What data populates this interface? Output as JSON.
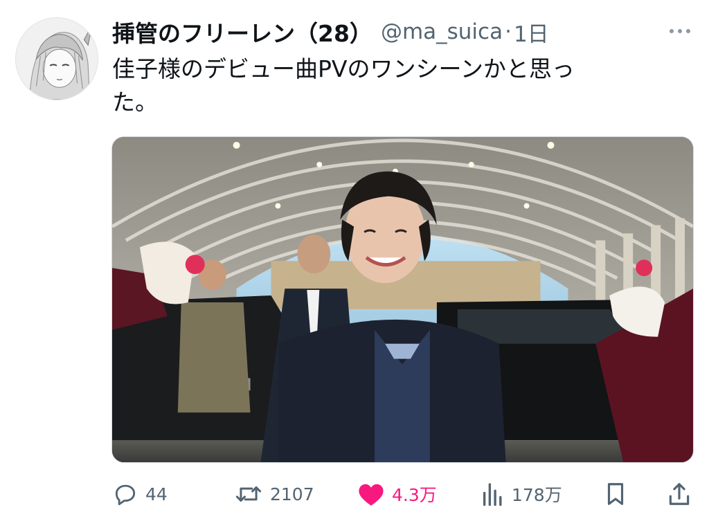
{
  "user": {
    "display_name": "挿管のフリーレン（28）",
    "handle": "@ma_suica",
    "separator": "·",
    "time": "1日",
    "avatar": "anime-girl-sketch-avatar"
  },
  "tweet": {
    "text_line1": "佳子様のデビュー曲PVのワンシーンかと思っ",
    "text_line2": "た。",
    "media": "photo-woman-smiling-under-arched-canopy"
  },
  "actions": {
    "reply": {
      "icon": "reply-icon",
      "count": "44"
    },
    "retweet": {
      "icon": "retweet-icon",
      "count": "2107"
    },
    "like": {
      "icon": "heart-icon",
      "count": "4.3万",
      "color": "#f91880",
      "liked": true
    },
    "views": {
      "icon": "views-icon",
      "count": "178万"
    },
    "bookmark": {
      "icon": "bookmark-icon"
    },
    "share": {
      "icon": "share-icon"
    }
  },
  "colors": {
    "text_primary": "#0f1419",
    "text_secondary": "#536471",
    "like_active": "#f91880"
  }
}
